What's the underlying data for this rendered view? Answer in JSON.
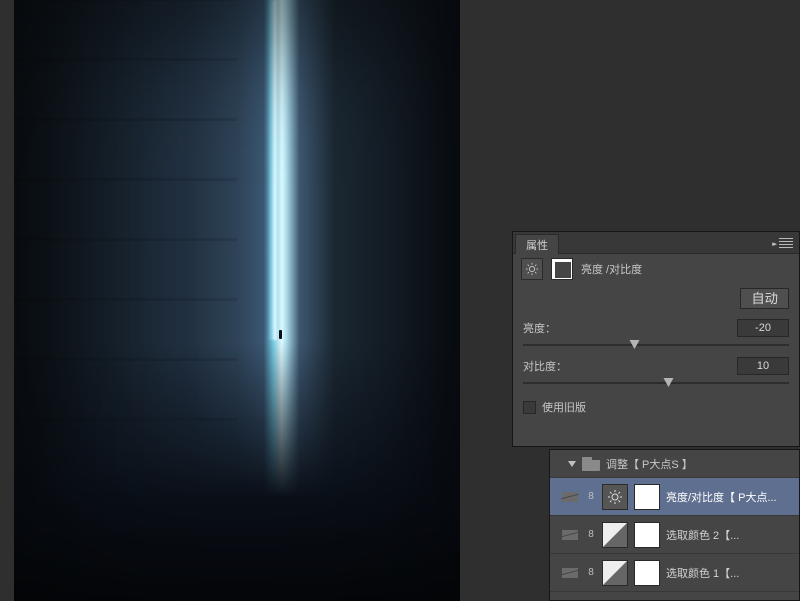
{
  "colors": {
    "panel_bg": "#454545",
    "workspace_bg": "#2f2f2f",
    "selected_layer": "#5f6f8f"
  },
  "properties": {
    "tab_label": "属性",
    "adjustment_title": "亮度 /对比度",
    "auto_button": "自动",
    "brightness_label": "亮度：",
    "brightness_value": "-20",
    "contrast_label": "对比度：",
    "contrast_value": "10",
    "use_legacy_label": "使用旧版"
  },
  "layers": {
    "group_label": "调整【 P大点S 】",
    "items": [
      {
        "label": "亮度/对比度【 P大点...",
        "icon": "sun",
        "selected": true
      },
      {
        "label": "选取颜色 2【...",
        "icon": "mask",
        "selected": false
      },
      {
        "label": "选取颜色 1【...",
        "icon": "mask",
        "selected": false
      }
    ]
  }
}
